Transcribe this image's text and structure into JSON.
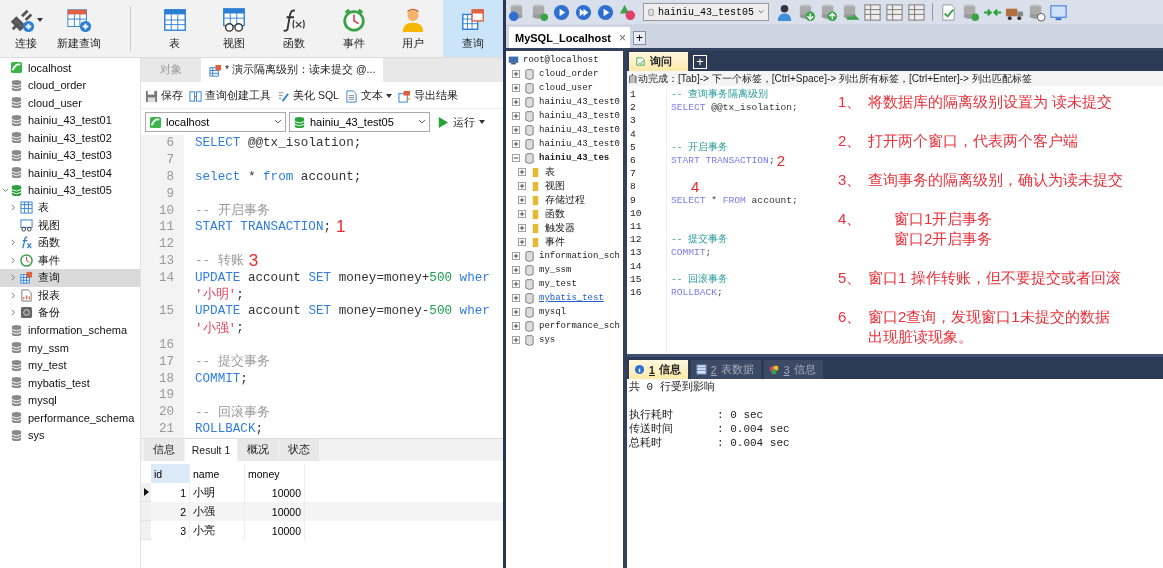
{
  "navicat": {
    "toolbar_left": [
      {
        "label": "连接",
        "kind": "connect",
        "dropdown": true,
        "selected": false
      },
      {
        "label": "新建查询",
        "kind": "new-query",
        "selected": false
      }
    ],
    "toolbar_main": [
      {
        "label": "表",
        "kind": "table",
        "selected": false
      },
      {
        "label": "视图",
        "kind": "view",
        "selected": false
      },
      {
        "label": "函数",
        "kind": "function",
        "selected": false
      },
      {
        "label": "事件",
        "kind": "event",
        "selected": false
      },
      {
        "label": "用户",
        "kind": "user",
        "selected": false
      },
      {
        "label": "查询",
        "kind": "query",
        "selected": true
      }
    ],
    "tree": [
      {
        "name": "localhost",
        "kind": "connection",
        "selected": false
      },
      {
        "name": "cloud_order",
        "kind": "database",
        "open": false,
        "selected": false
      },
      {
        "name": "cloud_user",
        "kind": "database",
        "open": false,
        "selected": false
      },
      {
        "name": "hainiu_43_test01",
        "kind": "database",
        "open": false,
        "selected": false
      },
      {
        "name": "hainiu_43_test02",
        "kind": "database",
        "open": false,
        "selected": false
      },
      {
        "name": "hainiu_43_test03",
        "kind": "database",
        "open": false,
        "selected": false
      },
      {
        "name": "hainiu_43_test04",
        "kind": "database",
        "open": false,
        "selected": false
      },
      {
        "name": "hainiu_43_test05",
        "kind": "database",
        "open": true,
        "expanded": true,
        "selected": false,
        "children": [
          {
            "name": "表",
            "kind": "table",
            "expanded": false,
            "selected": false
          },
          {
            "name": "视图",
            "kind": "view",
            "selected": false
          },
          {
            "name": "函数",
            "kind": "function",
            "expanded": false,
            "selected": false
          },
          {
            "name": "事件",
            "kind": "event",
            "expanded": false,
            "selected": false
          },
          {
            "name": "查询",
            "kind": "query",
            "expanded": false,
            "selected": true
          },
          {
            "name": "报表",
            "kind": "report",
            "expanded": false,
            "selected": false
          },
          {
            "name": "备份",
            "kind": "backup",
            "expanded": false,
            "selected": false
          }
        ]
      },
      {
        "name": "information_schema",
        "kind": "database",
        "open": false,
        "selected": false
      },
      {
        "name": "my_ssm",
        "kind": "database",
        "open": false,
        "selected": false
      },
      {
        "name": "my_test",
        "kind": "database",
        "open": false,
        "selected": false
      },
      {
        "name": "mybatis_test",
        "kind": "database",
        "open": false,
        "selected": false
      },
      {
        "name": "mysql",
        "kind": "database",
        "open": false,
        "selected": false
      },
      {
        "name": "performance_schema",
        "kind": "database",
        "open": false,
        "selected": false
      },
      {
        "name": "sys",
        "kind": "database",
        "open": false,
        "selected": false
      }
    ],
    "tabs": [
      {
        "label": "对象",
        "selected": false
      },
      {
        "label": "* 演示隔离级别：读未提交 @...",
        "selected": true
      }
    ],
    "editor_toolbar": [
      {
        "label": "保存",
        "kind": "save"
      },
      {
        "label": "查询创建工具",
        "kind": "builder"
      },
      {
        "label": "美化 SQL",
        "kind": "beautify"
      },
      {
        "label": "文本",
        "kind": "text",
        "dropdown": true
      },
      {
        "label": "导出结果",
        "kind": "export"
      }
    ],
    "connection_select": "localhost",
    "database_select": "hainiu_43_test05",
    "run_button": "运行",
    "editor_lines": [
      {
        "num": "6",
        "tokens": [
          {
            "t": "SELECT",
            "kind": "keyword"
          },
          {
            "t": " @@tx_isolation;",
            "kind": "plain"
          }
        ]
      },
      {
        "num": "7"
      },
      {
        "num": "8",
        "tokens": [
          {
            "t": "select",
            "kind": "keyword"
          },
          {
            "t": " * ",
            "kind": "plain"
          },
          {
            "t": "from",
            "kind": "keyword"
          },
          {
            "t": " account;",
            "kind": "plain"
          }
        ]
      },
      {
        "num": "9"
      },
      {
        "num": "10",
        "tokens": [
          {
            "t": "-- 开启事务",
            "kind": "comment"
          }
        ]
      },
      {
        "num": "11",
        "tokens": [
          {
            "t": "START TRANSACTION",
            "kind": "keyword"
          },
          {
            "t": ";",
            "kind": "plain"
          },
          {
            "t": "1",
            "kind": "note"
          }
        ]
      },
      {
        "num": "12"
      },
      {
        "num": "13",
        "tokens": [
          {
            "t": "-- 转账",
            "kind": "comment"
          },
          {
            "t": "3",
            "kind": "note"
          }
        ]
      },
      {
        "num": "14",
        "tokens": [
          {
            "t": "UPDATE",
            "kind": "keyword"
          },
          {
            "t": " account ",
            "kind": "plain"
          },
          {
            "t": "SET",
            "kind": "keyword"
          },
          {
            "t": " money=money+",
            "kind": "plain"
          },
          {
            "t": "500",
            "kind": "number"
          },
          {
            "t": " wher",
            "kind": "keyword"
          }
        ]
      },
      {
        "tokens": [
          {
            "t": "'小明'",
            "kind": "string"
          },
          {
            "t": ";",
            "kind": "plain"
          }
        ]
      },
      {
        "num": "15",
        "tokens": [
          {
            "t": "UPDATE",
            "kind": "keyword"
          },
          {
            "t": " account ",
            "kind": "plain"
          },
          {
            "t": "SET",
            "kind": "keyword"
          },
          {
            "t": " money=money-",
            "kind": "plain"
          },
          {
            "t": "500",
            "kind": "number"
          },
          {
            "t": " wher",
            "kind": "keyword"
          }
        ]
      },
      {
        "tokens": [
          {
            "t": "'小强'",
            "kind": "string"
          },
          {
            "t": ";",
            "kind": "plain"
          }
        ]
      },
      {
        "num": "16"
      },
      {
        "num": "17",
        "tokens": [
          {
            "t": "-- 提交事务",
            "kind": "comment"
          }
        ]
      },
      {
        "num": "18",
        "tokens": [
          {
            "t": "COMMIT",
            "kind": "keyword"
          },
          {
            "t": ";",
            "kind": "plain"
          }
        ]
      },
      {
        "num": "19"
      },
      {
        "num": "20",
        "tokens": [
          {
            "t": "-- 回滚事务",
            "kind": "comment"
          }
        ]
      },
      {
        "num": "21",
        "tokens": [
          {
            "t": "ROLLBACK",
            "kind": "keyword"
          },
          {
            "t": ";",
            "kind": "plain"
          }
        ]
      }
    ],
    "result_tabs": [
      {
        "label": "信息",
        "selected": false
      },
      {
        "label": "Result 1",
        "selected": true
      },
      {
        "label": "概况",
        "selected": false
      },
      {
        "label": "状态",
        "selected": false
      }
    ],
    "result_table": {
      "columns": [
        "id",
        "name",
        "money"
      ],
      "rows": [
        {
          "cells": [
            "1",
            "小明",
            "10000"
          ],
          "current": true
        },
        {
          "cells": [
            "2",
            "小强",
            "10000"
          ],
          "current": false
        },
        {
          "cells": [
            "3",
            "小亮",
            "10000"
          ],
          "current": false
        }
      ]
    }
  },
  "sqlyog": {
    "database_select": "hainiu_43_test05",
    "connection_tab": {
      "label": "MySQL_Localhost",
      "close": "×"
    },
    "new_tab": "+",
    "tree": {
      "root": "root@localhost",
      "items": [
        {
          "name": "cloud_order",
          "expanded": false,
          "selected": false,
          "hover": false
        },
        {
          "name": "cloud_user",
          "expanded": false,
          "selected": false,
          "hover": false
        },
        {
          "name": "hainiu_43_test0",
          "expanded": false,
          "selected": false,
          "hover": false
        },
        {
          "name": "hainiu_43_test0",
          "expanded": false,
          "selected": false,
          "hover": false
        },
        {
          "name": "hainiu_43_test0",
          "expanded": false,
          "selected": false,
          "hover": false
        },
        {
          "name": "hainiu_43_test0",
          "expanded": false,
          "selected": false,
          "hover": false
        },
        {
          "name": "hainiu_43_tes",
          "expanded": true,
          "selected": true,
          "hover": false,
          "children": [
            {
              "name": "表",
              "expanded": false
            },
            {
              "name": "视图",
              "expanded": false
            },
            {
              "name": "存储过程",
              "expanded": false
            },
            {
              "name": "函数",
              "expanded": false
            },
            {
              "name": "触发器",
              "expanded": false
            },
            {
              "name": "事件",
              "expanded": false
            }
          ]
        },
        {
          "name": "information_sch",
          "expanded": false,
          "selected": false,
          "hover": false
        },
        {
          "name": "my_ssm",
          "expanded": false,
          "selected": false,
          "hover": false
        },
        {
          "name": "my_test",
          "expanded": false,
          "selected": false,
          "hover": false
        },
        {
          "name": "mybatis_test",
          "expanded": false,
          "selected": false,
          "hover": true
        },
        {
          "name": "mysql",
          "expanded": false,
          "selected": false,
          "hover": false
        },
        {
          "name": "performance_sch",
          "expanded": false,
          "selected": false,
          "hover": false
        },
        {
          "name": "sys",
          "expanded": false,
          "selected": false,
          "hover": false
        }
      ]
    },
    "query_tab": "询问",
    "query_new_tab": "+",
    "autocomplete_hint": "自动完成：[Tab]-> 下一个标签，[Ctrl+Space]-> 列出所有标签，[Ctrl+Enter]-> 列出匹配标签",
    "editor_lines": [
      {
        "num": "1",
        "tokens": [
          {
            "t": "-- 查询事务隔离级别",
            "kind": "comment"
          }
        ]
      },
      {
        "num": "2",
        "tokens": [
          {
            "t": "SELECT",
            "kind": "keyword"
          },
          {
            "t": " @@tx_isolation;",
            "kind": "plain"
          }
        ]
      },
      {
        "num": "3"
      },
      {
        "num": "4"
      },
      {
        "num": "5",
        "tokens": [
          {
            "t": "-- 开启事务",
            "kind": "comment"
          }
        ]
      },
      {
        "num": "6",
        "tokens": [
          {
            "t": "START TRANSACTION",
            "kind": "keyword"
          },
          {
            "t": ";",
            "kind": "plain"
          },
          {
            "t": "2",
            "kind": "note"
          }
        ]
      },
      {
        "num": "7"
      },
      {
        "num": "8",
        "tokens": [
          {
            "t": "4",
            "kind": "note"
          }
        ]
      },
      {
        "num": "9",
        "tokens": [
          {
            "t": "SELECT",
            "kind": "keyword"
          },
          {
            "t": " * ",
            "kind": "plain"
          },
          {
            "t": "FROM",
            "kind": "keyword"
          },
          {
            "t": " account;",
            "kind": "plain"
          }
        ]
      },
      {
        "num": "10"
      },
      {
        "num": "11"
      },
      {
        "num": "12",
        "tokens": [
          {
            "t": "-- 提交事务",
            "kind": "comment"
          }
        ]
      },
      {
        "num": "13",
        "tokens": [
          {
            "t": "COMMIT",
            "kind": "keyword"
          },
          {
            "t": ";",
            "kind": "plain"
          }
        ]
      },
      {
        "num": "14"
      },
      {
        "num": "15",
        "tokens": [
          {
            "t": "-- 回滚事务",
            "kind": "comment"
          }
        ]
      },
      {
        "num": "16",
        "tokens": [
          {
            "t": "ROLLBACK",
            "kind": "keyword"
          },
          {
            "t": ";",
            "kind": "plain"
          }
        ]
      }
    ],
    "notes": [
      {
        "marker": "1、",
        "kind": "plain",
        "lines": [
          "将数据库的隔离级别设置为 读未提交"
        ]
      },
      {
        "marker": "2、",
        "kind": "plain",
        "lines": [
          "打开两个窗口，代表两个客户端"
        ]
      },
      {
        "marker": "3、",
        "kind": "plain",
        "lines": [
          "查询事务的隔离级别，确认为读未提交"
        ]
      },
      {
        "marker": "4、",
        "kind": "indented",
        "lines": [
          "窗口1开启事务",
          "窗口2开启事务"
        ]
      },
      {
        "marker": "5、",
        "kind": "plain",
        "lines": [
          "窗口1 操作转账，但不要提交或者回滚"
        ]
      },
      {
        "marker": "6、",
        "kind": "plain",
        "lines": [
          "窗口2查询，发现窗口1未提交的数据",
          "出现脏读现象。"
        ]
      }
    ],
    "result_tabs": [
      {
        "number": "1",
        "label": "信息",
        "kind": "info",
        "selected": true
      },
      {
        "number": "2",
        "label": "表数据",
        "kind": "grid",
        "selected": false
      },
      {
        "number": "3",
        "label": "信息",
        "kind": "messages",
        "selected": false
      }
    ],
    "result_summary": "共 0 行受到影响",
    "timings": [
      {
        "label": "执行耗时",
        "value": ": 0 sec"
      },
      {
        "label": "传送时间",
        "value": ": 0.004 sec"
      },
      {
        "label": "总耗时",
        "value": ": 0.004 sec"
      }
    ]
  }
}
